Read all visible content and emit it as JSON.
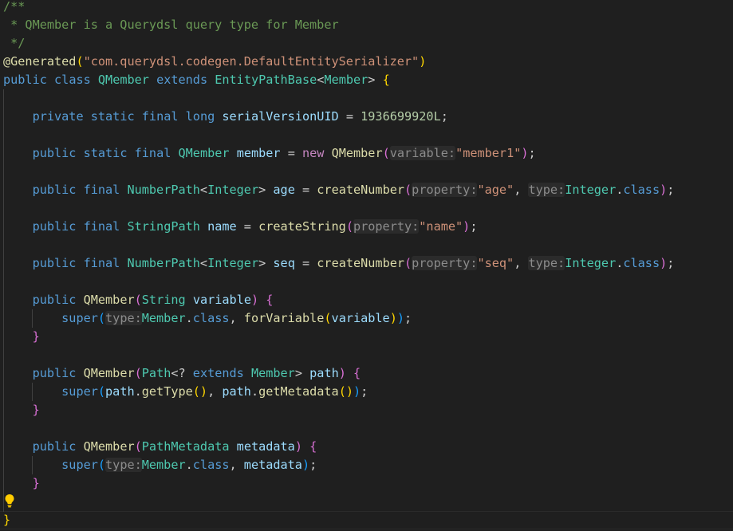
{
  "colors": {
    "background": "#1f1f1f",
    "comment": "#6a9955",
    "keyword": "#569cd6",
    "control": "#c586c0",
    "type": "#4ec9b0",
    "string": "#ce9178",
    "number": "#b5cea8",
    "variable": "#9cdcfe",
    "function": "#dcdcaa",
    "annotation": "#dcdcaa",
    "punct": "#cccccc",
    "hint": "#8c8c8c",
    "bracket1": "#ffd700",
    "bracket2": "#da70d6",
    "bracket3": "#179fff",
    "bulb": "#ffcc00"
  },
  "icons": {
    "lightbulb": "lightbulb-icon"
  },
  "lines": [
    [
      {
        "t": "/**",
        "c": "comment"
      }
    ],
    [
      {
        "t": " * QMember is a Querydsl query type for Member",
        "c": "comment"
      }
    ],
    [
      {
        "t": " */",
        "c": "comment"
      }
    ],
    [
      {
        "t": "@Generated",
        "c": "annotation"
      },
      {
        "t": "(",
        "c": "bracket1"
      },
      {
        "t": "\"com.querydsl.codegen.DefaultEntitySerializer\"",
        "c": "string"
      },
      {
        "t": ")",
        "c": "bracket1"
      }
    ],
    [
      {
        "t": "public",
        "c": "keyword"
      },
      {
        "t": " ",
        "c": "punct"
      },
      {
        "t": "class",
        "c": "keyword"
      },
      {
        "t": " ",
        "c": "punct"
      },
      {
        "t": "QMember",
        "c": "type"
      },
      {
        "t": " ",
        "c": "punct"
      },
      {
        "t": "extends",
        "c": "keyword"
      },
      {
        "t": " ",
        "c": "punct"
      },
      {
        "t": "EntityPathBase",
        "c": "type"
      },
      {
        "t": "<",
        "c": "punct"
      },
      {
        "t": "Member",
        "c": "type"
      },
      {
        "t": ">",
        "c": "punct"
      },
      {
        "t": " ",
        "c": "punct"
      },
      {
        "t": "{",
        "c": "bracket1"
      }
    ],
    [],
    [
      {
        "t": "    ",
        "c": "punct"
      },
      {
        "t": "private",
        "c": "keyword"
      },
      {
        "t": " ",
        "c": "punct"
      },
      {
        "t": "static",
        "c": "keyword"
      },
      {
        "t": " ",
        "c": "punct"
      },
      {
        "t": "final",
        "c": "keyword"
      },
      {
        "t": " ",
        "c": "punct"
      },
      {
        "t": "long",
        "c": "keyword"
      },
      {
        "t": " ",
        "c": "punct"
      },
      {
        "t": "serialVersionUID",
        "c": "variable"
      },
      {
        "t": " = ",
        "c": "punct"
      },
      {
        "t": "1936699920L",
        "c": "number"
      },
      {
        "t": ";",
        "c": "punct"
      }
    ],
    [],
    [
      {
        "t": "    ",
        "c": "punct"
      },
      {
        "t": "public",
        "c": "keyword"
      },
      {
        "t": " ",
        "c": "punct"
      },
      {
        "t": "static",
        "c": "keyword"
      },
      {
        "t": " ",
        "c": "punct"
      },
      {
        "t": "final",
        "c": "keyword"
      },
      {
        "t": " ",
        "c": "punct"
      },
      {
        "t": "QMember",
        "c": "type"
      },
      {
        "t": " ",
        "c": "punct"
      },
      {
        "t": "member",
        "c": "variable"
      },
      {
        "t": " = ",
        "c": "punct"
      },
      {
        "t": "new",
        "c": "control"
      },
      {
        "t": " ",
        "c": "punct"
      },
      {
        "t": "QMember",
        "c": "function"
      },
      {
        "t": "(",
        "c": "bracket2"
      },
      {
        "t": "variable:",
        "c": "hint"
      },
      {
        "t": "\"member1\"",
        "c": "string"
      },
      {
        "t": ")",
        "c": "bracket2"
      },
      {
        "t": ";",
        "c": "punct"
      }
    ],
    [],
    [
      {
        "t": "    ",
        "c": "punct"
      },
      {
        "t": "public",
        "c": "keyword"
      },
      {
        "t": " ",
        "c": "punct"
      },
      {
        "t": "final",
        "c": "keyword"
      },
      {
        "t": " ",
        "c": "punct"
      },
      {
        "t": "NumberPath",
        "c": "type"
      },
      {
        "t": "<",
        "c": "punct"
      },
      {
        "t": "Integer",
        "c": "type"
      },
      {
        "t": ">",
        "c": "punct"
      },
      {
        "t": " ",
        "c": "punct"
      },
      {
        "t": "age",
        "c": "variable"
      },
      {
        "t": " = ",
        "c": "punct"
      },
      {
        "t": "createNumber",
        "c": "function"
      },
      {
        "t": "(",
        "c": "bracket2"
      },
      {
        "t": "property:",
        "c": "hint"
      },
      {
        "t": "\"age\"",
        "c": "string"
      },
      {
        "t": ", ",
        "c": "punct"
      },
      {
        "t": "type:",
        "c": "hint"
      },
      {
        "t": "Integer",
        "c": "type"
      },
      {
        "t": ".",
        "c": "punct"
      },
      {
        "t": "class",
        "c": "keyword"
      },
      {
        "t": ")",
        "c": "bracket2"
      },
      {
        "t": ";",
        "c": "punct"
      }
    ],
    [],
    [
      {
        "t": "    ",
        "c": "punct"
      },
      {
        "t": "public",
        "c": "keyword"
      },
      {
        "t": " ",
        "c": "punct"
      },
      {
        "t": "final",
        "c": "keyword"
      },
      {
        "t": " ",
        "c": "punct"
      },
      {
        "t": "StringPath",
        "c": "type"
      },
      {
        "t": " ",
        "c": "punct"
      },
      {
        "t": "name",
        "c": "variable"
      },
      {
        "t": " = ",
        "c": "punct"
      },
      {
        "t": "createString",
        "c": "function"
      },
      {
        "t": "(",
        "c": "bracket2"
      },
      {
        "t": "property:",
        "c": "hint"
      },
      {
        "t": "\"name\"",
        "c": "string"
      },
      {
        "t": ")",
        "c": "bracket2"
      },
      {
        "t": ";",
        "c": "punct"
      }
    ],
    [],
    [
      {
        "t": "    ",
        "c": "punct"
      },
      {
        "t": "public",
        "c": "keyword"
      },
      {
        "t": " ",
        "c": "punct"
      },
      {
        "t": "final",
        "c": "keyword"
      },
      {
        "t": " ",
        "c": "punct"
      },
      {
        "t": "NumberPath",
        "c": "type"
      },
      {
        "t": "<",
        "c": "punct"
      },
      {
        "t": "Integer",
        "c": "type"
      },
      {
        "t": ">",
        "c": "punct"
      },
      {
        "t": " ",
        "c": "punct"
      },
      {
        "t": "seq",
        "c": "variable"
      },
      {
        "t": " = ",
        "c": "punct"
      },
      {
        "t": "createNumber",
        "c": "function"
      },
      {
        "t": "(",
        "c": "bracket2"
      },
      {
        "t": "property:",
        "c": "hint"
      },
      {
        "t": "\"seq\"",
        "c": "string"
      },
      {
        "t": ", ",
        "c": "punct"
      },
      {
        "t": "type:",
        "c": "hint"
      },
      {
        "t": "Integer",
        "c": "type"
      },
      {
        "t": ".",
        "c": "punct"
      },
      {
        "t": "class",
        "c": "keyword"
      },
      {
        "t": ")",
        "c": "bracket2"
      },
      {
        "t": ";",
        "c": "punct"
      }
    ],
    [],
    [
      {
        "t": "    ",
        "c": "punct"
      },
      {
        "t": "public",
        "c": "keyword"
      },
      {
        "t": " ",
        "c": "punct"
      },
      {
        "t": "QMember",
        "c": "function"
      },
      {
        "t": "(",
        "c": "bracket2"
      },
      {
        "t": "String",
        "c": "type"
      },
      {
        "t": " ",
        "c": "punct"
      },
      {
        "t": "variable",
        "c": "variable"
      },
      {
        "t": ")",
        "c": "bracket2"
      },
      {
        "t": " ",
        "c": "punct"
      },
      {
        "t": "{",
        "c": "bracket2"
      }
    ],
    [
      {
        "t": "        ",
        "c": "punct"
      },
      {
        "t": "super",
        "c": "keyword"
      },
      {
        "t": "(",
        "c": "bracket3"
      },
      {
        "t": "type:",
        "c": "hint"
      },
      {
        "t": "Member",
        "c": "type"
      },
      {
        "t": ".",
        "c": "punct"
      },
      {
        "t": "class",
        "c": "keyword"
      },
      {
        "t": ", ",
        "c": "punct"
      },
      {
        "t": "forVariable",
        "c": "function"
      },
      {
        "t": "(",
        "c": "bracket1"
      },
      {
        "t": "variable",
        "c": "variable"
      },
      {
        "t": ")",
        "c": "bracket1"
      },
      {
        "t": ")",
        "c": "bracket3"
      },
      {
        "t": ";",
        "c": "punct"
      }
    ],
    [
      {
        "t": "    ",
        "c": "punct"
      },
      {
        "t": "}",
        "c": "bracket2"
      }
    ],
    [],
    [
      {
        "t": "    ",
        "c": "punct"
      },
      {
        "t": "public",
        "c": "keyword"
      },
      {
        "t": " ",
        "c": "punct"
      },
      {
        "t": "QMember",
        "c": "function"
      },
      {
        "t": "(",
        "c": "bracket2"
      },
      {
        "t": "Path",
        "c": "type"
      },
      {
        "t": "<? ",
        "c": "punct"
      },
      {
        "t": "extends",
        "c": "keyword"
      },
      {
        "t": " ",
        "c": "punct"
      },
      {
        "t": "Member",
        "c": "type"
      },
      {
        "t": ">",
        "c": "punct"
      },
      {
        "t": " ",
        "c": "punct"
      },
      {
        "t": "path",
        "c": "variable"
      },
      {
        "t": ")",
        "c": "bracket2"
      },
      {
        "t": " ",
        "c": "punct"
      },
      {
        "t": "{",
        "c": "bracket2"
      }
    ],
    [
      {
        "t": "        ",
        "c": "punct"
      },
      {
        "t": "super",
        "c": "keyword"
      },
      {
        "t": "(",
        "c": "bracket3"
      },
      {
        "t": "path",
        "c": "variable"
      },
      {
        "t": ".",
        "c": "punct"
      },
      {
        "t": "getType",
        "c": "function"
      },
      {
        "t": "()",
        "c": "bracket1"
      },
      {
        "t": ", ",
        "c": "punct"
      },
      {
        "t": "path",
        "c": "variable"
      },
      {
        "t": ".",
        "c": "punct"
      },
      {
        "t": "getMetadata",
        "c": "function"
      },
      {
        "t": "()",
        "c": "bracket1"
      },
      {
        "t": ")",
        "c": "bracket3"
      },
      {
        "t": ";",
        "c": "punct"
      }
    ],
    [
      {
        "t": "    ",
        "c": "punct"
      },
      {
        "t": "}",
        "c": "bracket2"
      }
    ],
    [],
    [
      {
        "t": "    ",
        "c": "punct"
      },
      {
        "t": "public",
        "c": "keyword"
      },
      {
        "t": " ",
        "c": "punct"
      },
      {
        "t": "QMember",
        "c": "function"
      },
      {
        "t": "(",
        "c": "bracket2"
      },
      {
        "t": "PathMetadata",
        "c": "type"
      },
      {
        "t": " ",
        "c": "punct"
      },
      {
        "t": "metadata",
        "c": "variable"
      },
      {
        "t": ")",
        "c": "bracket2"
      },
      {
        "t": " ",
        "c": "punct"
      },
      {
        "t": "{",
        "c": "bracket2"
      }
    ],
    [
      {
        "t": "        ",
        "c": "punct"
      },
      {
        "t": "super",
        "c": "keyword"
      },
      {
        "t": "(",
        "c": "bracket3"
      },
      {
        "t": "type:",
        "c": "hint"
      },
      {
        "t": "Member",
        "c": "type"
      },
      {
        "t": ".",
        "c": "punct"
      },
      {
        "t": "class",
        "c": "keyword"
      },
      {
        "t": ", ",
        "c": "punct"
      },
      {
        "t": "metadata",
        "c": "variable"
      },
      {
        "t": ")",
        "c": "bracket3"
      },
      {
        "t": ";",
        "c": "punct"
      }
    ],
    [
      {
        "t": "    ",
        "c": "punct"
      },
      {
        "t": "}",
        "c": "bracket2"
      }
    ],
    [],
    [
      {
        "t": "}",
        "c": "bracket1"
      }
    ]
  ]
}
